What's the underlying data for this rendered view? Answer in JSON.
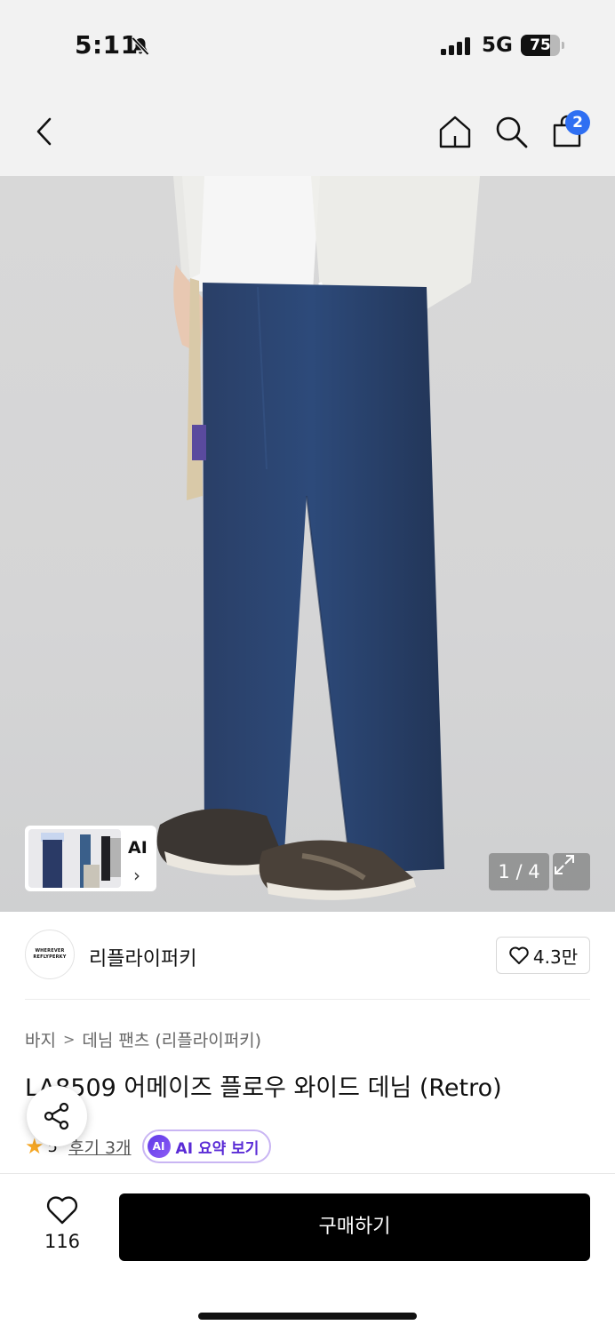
{
  "status_bar": {
    "time": "5:11",
    "network": "5G",
    "battery_level": 75,
    "battery_text": "75",
    "icons": [
      "bell-slash-icon",
      "signal-icon",
      "battery-icon"
    ]
  },
  "nav": {
    "icons": [
      "chevron-left-icon",
      "home-icon",
      "search-icon",
      "shopping-bag-icon"
    ],
    "cart_count": "2"
  },
  "gallery": {
    "ai_label": "AI",
    "ai_chevron": "›",
    "page_indicator": "1 / 4",
    "current": 1,
    "total": 4,
    "expand_icon": "expand-arrows-icon"
  },
  "brand": {
    "logo_line1": "WHEREVER",
    "logo_line2": "REFLYPERKY",
    "name": "리플라이퍼키",
    "like_count": "4.3만"
  },
  "breadcrumb": {
    "level1": "바지",
    "separator": ">",
    "level2": "데님 팬츠 (리플라이퍼키)"
  },
  "product": {
    "title": "LA8509 어메이즈 플로우 와이드 데님 (Retro)",
    "rating": "5",
    "reviews_label": "후기 3개",
    "ai_badge": "AI",
    "ai_summary_label": "AI 요약 보기"
  },
  "bottom": {
    "wish_count": "116",
    "buy_label": "구매하기"
  },
  "colors": {
    "accent_blue": "#2f6ff2",
    "ai_purple": "#5a2bd6",
    "buy_button": "#000000",
    "star": "#f5a623",
    "denim": "#2b426e"
  }
}
